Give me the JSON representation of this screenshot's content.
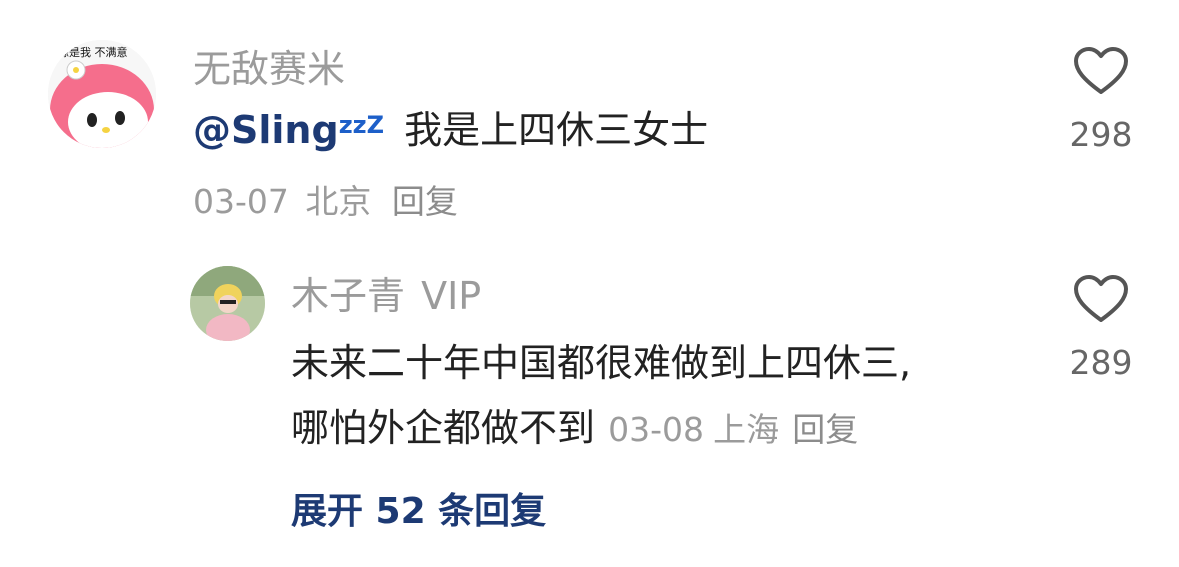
{
  "comment": {
    "username": "无敌赛米",
    "avatar_caption": "缘是我 不满意",
    "mention": "@Sling",
    "mention_emoji": "zzZ",
    "text": "我是上四休三女士",
    "date": "03-07",
    "location": "北京",
    "reply_label": "回复",
    "likes": "298",
    "like_icon": "heart-outline-icon"
  },
  "reply": {
    "username": "木子青",
    "badge": "VIP",
    "text_line1": "未来二十年中国都很难做到上四休三,",
    "text_line2": "哪怕外企都做不到",
    "date": "03-08",
    "location": "上海",
    "reply_label": "回复",
    "likes": "289",
    "like_icon": "heart-outline-icon"
  },
  "expand_label": "展开 52 条回复",
  "colors": {
    "username": "#9b9b9b",
    "mention": "#1d3a74",
    "text": "#222222",
    "expand": "#1d3a74"
  }
}
